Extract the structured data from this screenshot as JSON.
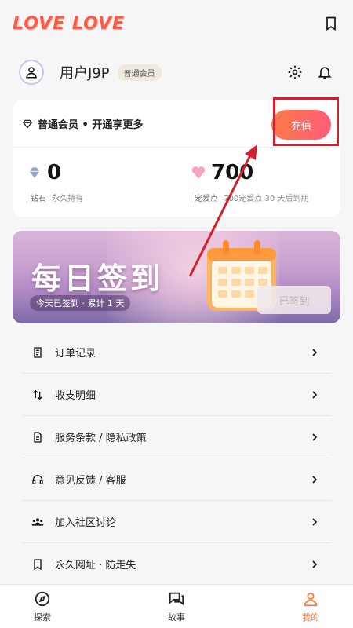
{
  "app": {
    "logo_text": "LOVE LOVE",
    "brand_color": "#ff5a45",
    "accent_gradient": [
      "#ff7a45",
      "#ff5d7a"
    ]
  },
  "header": {
    "icons": [
      "bookmark-icon"
    ]
  },
  "user": {
    "name": "用户J9P",
    "badge": "普通会员",
    "icons": [
      "avatar-user-icon",
      "gear-icon",
      "bell-icon"
    ]
  },
  "member_card": {
    "tier_text": "普通会员 • 开通享更多",
    "recharge_label": "充值",
    "diamonds": {
      "value": "0",
      "label": "钻石",
      "note": "永久持有"
    },
    "points": {
      "value": "700",
      "label": "宠爱点",
      "note": "700宠爱点 30 天后到期"
    }
  },
  "banner": {
    "title": "每日签到",
    "subtitle": "今天已签到 · 累计 1 天",
    "signed_label": "已签到"
  },
  "menu": [
    {
      "label": "订单记录",
      "icon": "receipt-icon"
    },
    {
      "label": "收支明细",
      "icon": "swap-arrows-icon"
    },
    {
      "label": "服务条款 / 隐私政策",
      "icon": "document-icon"
    },
    {
      "label": "意见反馈 / 客服",
      "icon": "headset-icon"
    },
    {
      "label": "加入社区讨论",
      "icon": "community-icon"
    },
    {
      "label": "永久网址 · 防走失",
      "icon": "bookmark-icon"
    }
  ],
  "bottom_nav": [
    {
      "label": "探索",
      "icon": "compass-icon",
      "active": false
    },
    {
      "label": "故事",
      "icon": "chat-bubbles-icon",
      "active": false
    },
    {
      "label": "我的",
      "icon": "person-icon",
      "active": true
    }
  ]
}
